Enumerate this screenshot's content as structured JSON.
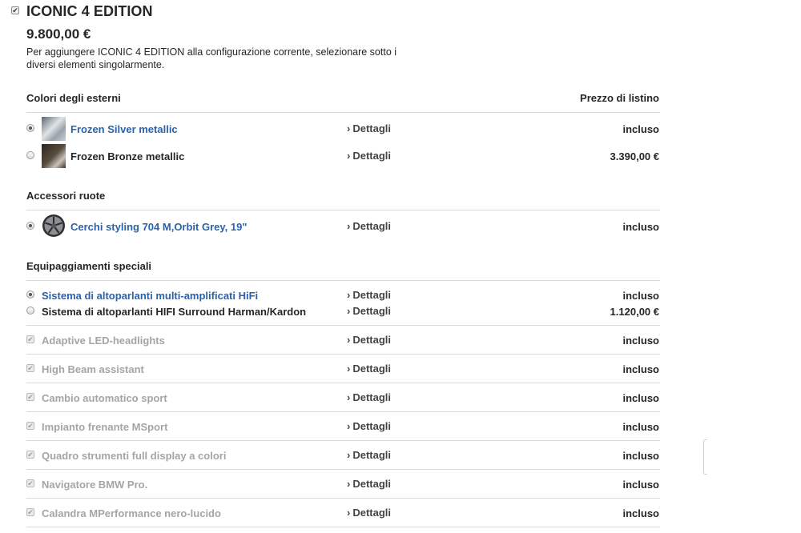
{
  "package": {
    "title": "ICONIC 4 EDITION",
    "price": "9.800,00 €",
    "description": "Per aggiungere ICONIC 4 EDITION alla configurazione corrente, selezionare sotto i diversi elementi singolarmente.",
    "checked": true
  },
  "exterior": {
    "section_label": "Colori degli esterni",
    "price_header": "Prezzo di listino",
    "items": [
      {
        "label": "Frozen Silver metallic",
        "details": "Dettagli",
        "price": "incluso",
        "selected": true
      },
      {
        "label": "Frozen Bronze metallic",
        "details": "Dettagli",
        "price": "3.390,00 €",
        "selected": false
      }
    ]
  },
  "wheels": {
    "section_label": "Accessori ruote",
    "items": [
      {
        "label": "Cerchi styling 704 M,Orbit Grey, 19\"",
        "details": "Dettagli",
        "price": "incluso",
        "selected": true
      }
    ]
  },
  "special": {
    "section_label": "Equipaggiamenti speciali",
    "radio_items": [
      {
        "label": "Sistema di altoparlanti multi-amplificati HiFi",
        "details": "Dettagli",
        "price": "incluso",
        "selected": true
      },
      {
        "label": "Sistema di altoparlanti HIFI Surround Harman/Kardon",
        "details": "Dettagli",
        "price": "1.120,00 €",
        "selected": false
      }
    ],
    "included_items": [
      {
        "label": "Adaptive LED-headlights",
        "details": "Dettagli",
        "price": "incluso"
      },
      {
        "label": "High Beam assistant",
        "details": "Dettagli",
        "price": "incluso"
      },
      {
        "label": "Cambio automatico sport",
        "details": "Dettagli",
        "price": "incluso"
      },
      {
        "label": "Impianto frenante MSport",
        "details": "Dettagli",
        "price": "incluso"
      },
      {
        "label": "Quadro strumenti full display a colori",
        "details": "Dettagli",
        "price": "incluso"
      },
      {
        "label": "Navigatore BMW Pro.",
        "details": "Dettagli",
        "price": "incluso"
      },
      {
        "label": "Calandra MPerformance nero-lucido",
        "details": "Dettagli",
        "price": "incluso"
      }
    ]
  },
  "icons": {
    "chevron": "chevron-right-icon",
    "check": "checkmark-icon",
    "silver_swatch": "silver-paint-swatch",
    "bronze_swatch": "bronze-paint-swatch",
    "wheel": "wheel-rim-icon"
  },
  "colors": {
    "link_blue": "#2a62ab",
    "text": "#262626",
    "disabled_text": "#a5a5a5",
    "divider": "#d9d9d9"
  }
}
